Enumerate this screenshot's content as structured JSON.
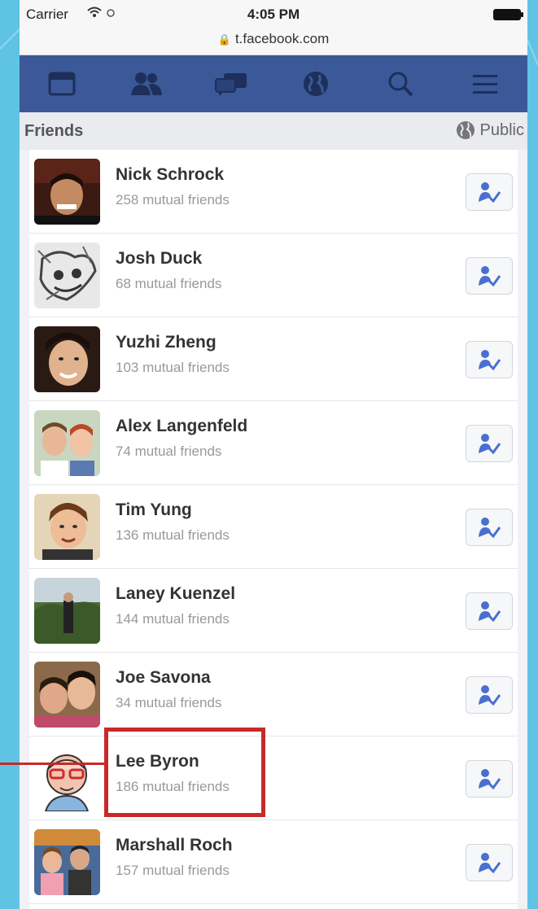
{
  "status_bar": {
    "carrier": "Carrier",
    "time": "4:05 PM"
  },
  "browser": {
    "url": "t.facebook.com"
  },
  "nav": {
    "items": [
      {
        "icon": "news-feed-icon"
      },
      {
        "icon": "friends-icon"
      },
      {
        "icon": "messages-icon"
      },
      {
        "icon": "globe-notifications-icon"
      },
      {
        "icon": "search-icon"
      },
      {
        "icon": "menu-icon"
      }
    ],
    "color": "#3b5998"
  },
  "section": {
    "title": "Friends",
    "privacy": "Public"
  },
  "friends": [
    {
      "name": "Nick Schrock",
      "mutual": "258 mutual friends"
    },
    {
      "name": "Josh Duck",
      "mutual": "68 mutual friends"
    },
    {
      "name": "Yuzhi Zheng",
      "mutual": "103 mutual friends"
    },
    {
      "name": "Alex Langenfeld",
      "mutual": "74 mutual friends"
    },
    {
      "name": "Tim Yung",
      "mutual": "136 mutual friends"
    },
    {
      "name": "Laney Kuenzel",
      "mutual": "144 mutual friends"
    },
    {
      "name": "Joe Savona",
      "mutual": "34 mutual friends"
    },
    {
      "name": "Lee Byron",
      "mutual": "186 mutual friends"
    },
    {
      "name": "Marshall Roch",
      "mutual": "157 mutual friends"
    }
  ],
  "colors": {
    "background": "#5fc3e4",
    "highlight": "#c62a2a"
  }
}
